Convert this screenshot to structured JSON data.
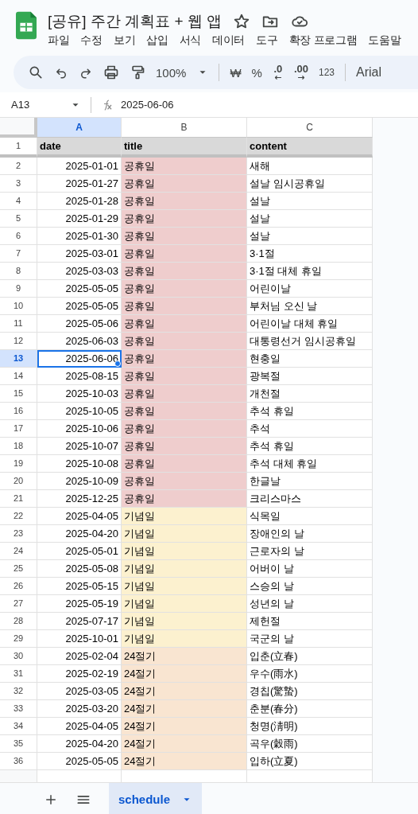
{
  "document": {
    "title": "[공유] 주간 계획표 + 웹 앱"
  },
  "menu": [
    "파일",
    "수정",
    "보기",
    "삽입",
    "서식",
    "데이터",
    "도구",
    "확장 프로그램",
    "도움말"
  ],
  "toolbar": {
    "zoom": "100%",
    "currency": "₩",
    "percent": "%",
    "decrease_decimal": ".0",
    "increase_decimal": ".00",
    "number_format": "123",
    "font": "Arial"
  },
  "formula_bar": {
    "cell": "A13",
    "value": "2025-06-06"
  },
  "columns": [
    {
      "label": "A",
      "selected": true
    },
    {
      "label": "B",
      "selected": false
    },
    {
      "label": "C",
      "selected": false
    }
  ],
  "header_row": {
    "number": "1",
    "cells": [
      "date",
      "title",
      "content"
    ]
  },
  "rows": [
    {
      "number": "2",
      "date": "2025-01-01",
      "title": "공휴일",
      "content": "새해",
      "color": "#efcdcd",
      "selected": false
    },
    {
      "number": "3",
      "date": "2025-01-27",
      "title": "공휴일",
      "content": "설날 임시공휴일",
      "color": "#efcdcd",
      "selected": false
    },
    {
      "number": "4",
      "date": "2025-01-28",
      "title": "공휴일",
      "content": "설날",
      "color": "#efcdcd",
      "selected": false
    },
    {
      "number": "5",
      "date": "2025-01-29",
      "title": "공휴일",
      "content": "설날",
      "color": "#efcdcd",
      "selected": false
    },
    {
      "number": "6",
      "date": "2025-01-30",
      "title": "공휴일",
      "content": "설날",
      "color": "#efcdcd",
      "selected": false
    },
    {
      "number": "7",
      "date": "2025-03-01",
      "title": "공휴일",
      "content": "3·1절",
      "color": "#efcdcd",
      "selected": false
    },
    {
      "number": "8",
      "date": "2025-03-03",
      "title": "공휴일",
      "content": "3·1절 대체 휴일",
      "color": "#efcdcd",
      "selected": false
    },
    {
      "number": "9",
      "date": "2025-05-05",
      "title": "공휴일",
      "content": "어린이날",
      "color": "#efcdcd",
      "selected": false
    },
    {
      "number": "10",
      "date": "2025-05-05",
      "title": "공휴일",
      "content": "부처님 오신 날",
      "color": "#efcdcd",
      "selected": false
    },
    {
      "number": "11",
      "date": "2025-05-06",
      "title": "공휴일",
      "content": "어린이날 대체 휴일",
      "color": "#efcdcd",
      "selected": false
    },
    {
      "number": "12",
      "date": "2025-06-03",
      "title": "공휴일",
      "content": "대통령선거 임시공휴일",
      "color": "#efcdcd",
      "selected": false
    },
    {
      "number": "13",
      "date": "2025-06-06",
      "title": "공휴일",
      "content": "현충일",
      "color": "#efcdcd",
      "selected": true
    },
    {
      "number": "14",
      "date": "2025-08-15",
      "title": "공휴일",
      "content": "광복절",
      "color": "#efcdcd",
      "selected": false
    },
    {
      "number": "15",
      "date": "2025-10-03",
      "title": "공휴일",
      "content": "개천절",
      "color": "#efcdcd",
      "selected": false
    },
    {
      "number": "16",
      "date": "2025-10-05",
      "title": "공휴일",
      "content": "추석 휴일",
      "color": "#efcdcd",
      "selected": false
    },
    {
      "number": "17",
      "date": "2025-10-06",
      "title": "공휴일",
      "content": "추석",
      "color": "#efcdcd",
      "selected": false
    },
    {
      "number": "18",
      "date": "2025-10-07",
      "title": "공휴일",
      "content": "추석 휴일",
      "color": "#efcdcd",
      "selected": false
    },
    {
      "number": "19",
      "date": "2025-10-08",
      "title": "공휴일",
      "content": "추석 대체 휴일",
      "color": "#efcdcd",
      "selected": false
    },
    {
      "number": "20",
      "date": "2025-10-09",
      "title": "공휴일",
      "content": "한글날",
      "color": "#efcdcd",
      "selected": false
    },
    {
      "number": "21",
      "date": "2025-12-25",
      "title": "공휴일",
      "content": "크리스마스",
      "color": "#efcdcd",
      "selected": false
    },
    {
      "number": "22",
      "date": "2025-04-05",
      "title": "기념일",
      "content": "식목일",
      "color": "#fcf1cf",
      "selected": false
    },
    {
      "number": "23",
      "date": "2025-04-20",
      "title": "기념일",
      "content": "장애인의 날",
      "color": "#fcf1cf",
      "selected": false
    },
    {
      "number": "24",
      "date": "2025-05-01",
      "title": "기념일",
      "content": "근로자의 날",
      "color": "#fcf1cf",
      "selected": false
    },
    {
      "number": "25",
      "date": "2025-05-08",
      "title": "기념일",
      "content": "어버이 날",
      "color": "#fcf1cf",
      "selected": false
    },
    {
      "number": "26",
      "date": "2025-05-15",
      "title": "기념일",
      "content": "스승의 날",
      "color": "#fcf1cf",
      "selected": false
    },
    {
      "number": "27",
      "date": "2025-05-19",
      "title": "기념일",
      "content": "성년의 날",
      "color": "#fcf1cf",
      "selected": false
    },
    {
      "number": "28",
      "date": "2025-07-17",
      "title": "기념일",
      "content": "제헌절",
      "color": "#fcf1cf",
      "selected": false
    },
    {
      "number": "29",
      "date": "2025-10-01",
      "title": "기념일",
      "content": "국군의 날",
      "color": "#fcf1cf",
      "selected": false
    },
    {
      "number": "30",
      "date": "2025-02-04",
      "title": "24절기",
      "content": "입춘(立春)",
      "color": "#f9e5d1",
      "selected": false
    },
    {
      "number": "31",
      "date": "2025-02-19",
      "title": "24절기",
      "content": "우수(雨水)",
      "color": "#f9e5d1",
      "selected": false
    },
    {
      "number": "32",
      "date": "2025-03-05",
      "title": "24절기",
      "content": "경칩(驚蟄)",
      "color": "#f9e5d1",
      "selected": false
    },
    {
      "number": "33",
      "date": "2025-03-20",
      "title": "24절기",
      "content": "춘분(春分)",
      "color": "#f9e5d1",
      "selected": false
    },
    {
      "number": "34",
      "date": "2025-04-05",
      "title": "24절기",
      "content": "청명(淸明)",
      "color": "#f9e5d1",
      "selected": false
    },
    {
      "number": "35",
      "date": "2025-04-20",
      "title": "24절기",
      "content": "곡우(穀雨)",
      "color": "#f9e5d1",
      "selected": false
    },
    {
      "number": "36",
      "date": "2025-05-05",
      "title": "24절기",
      "content": "입하(立夏)",
      "color": "#f9e5d1",
      "selected": false
    }
  ],
  "sheet_tabs": [
    {
      "label": "schedule",
      "selected": true
    }
  ]
}
